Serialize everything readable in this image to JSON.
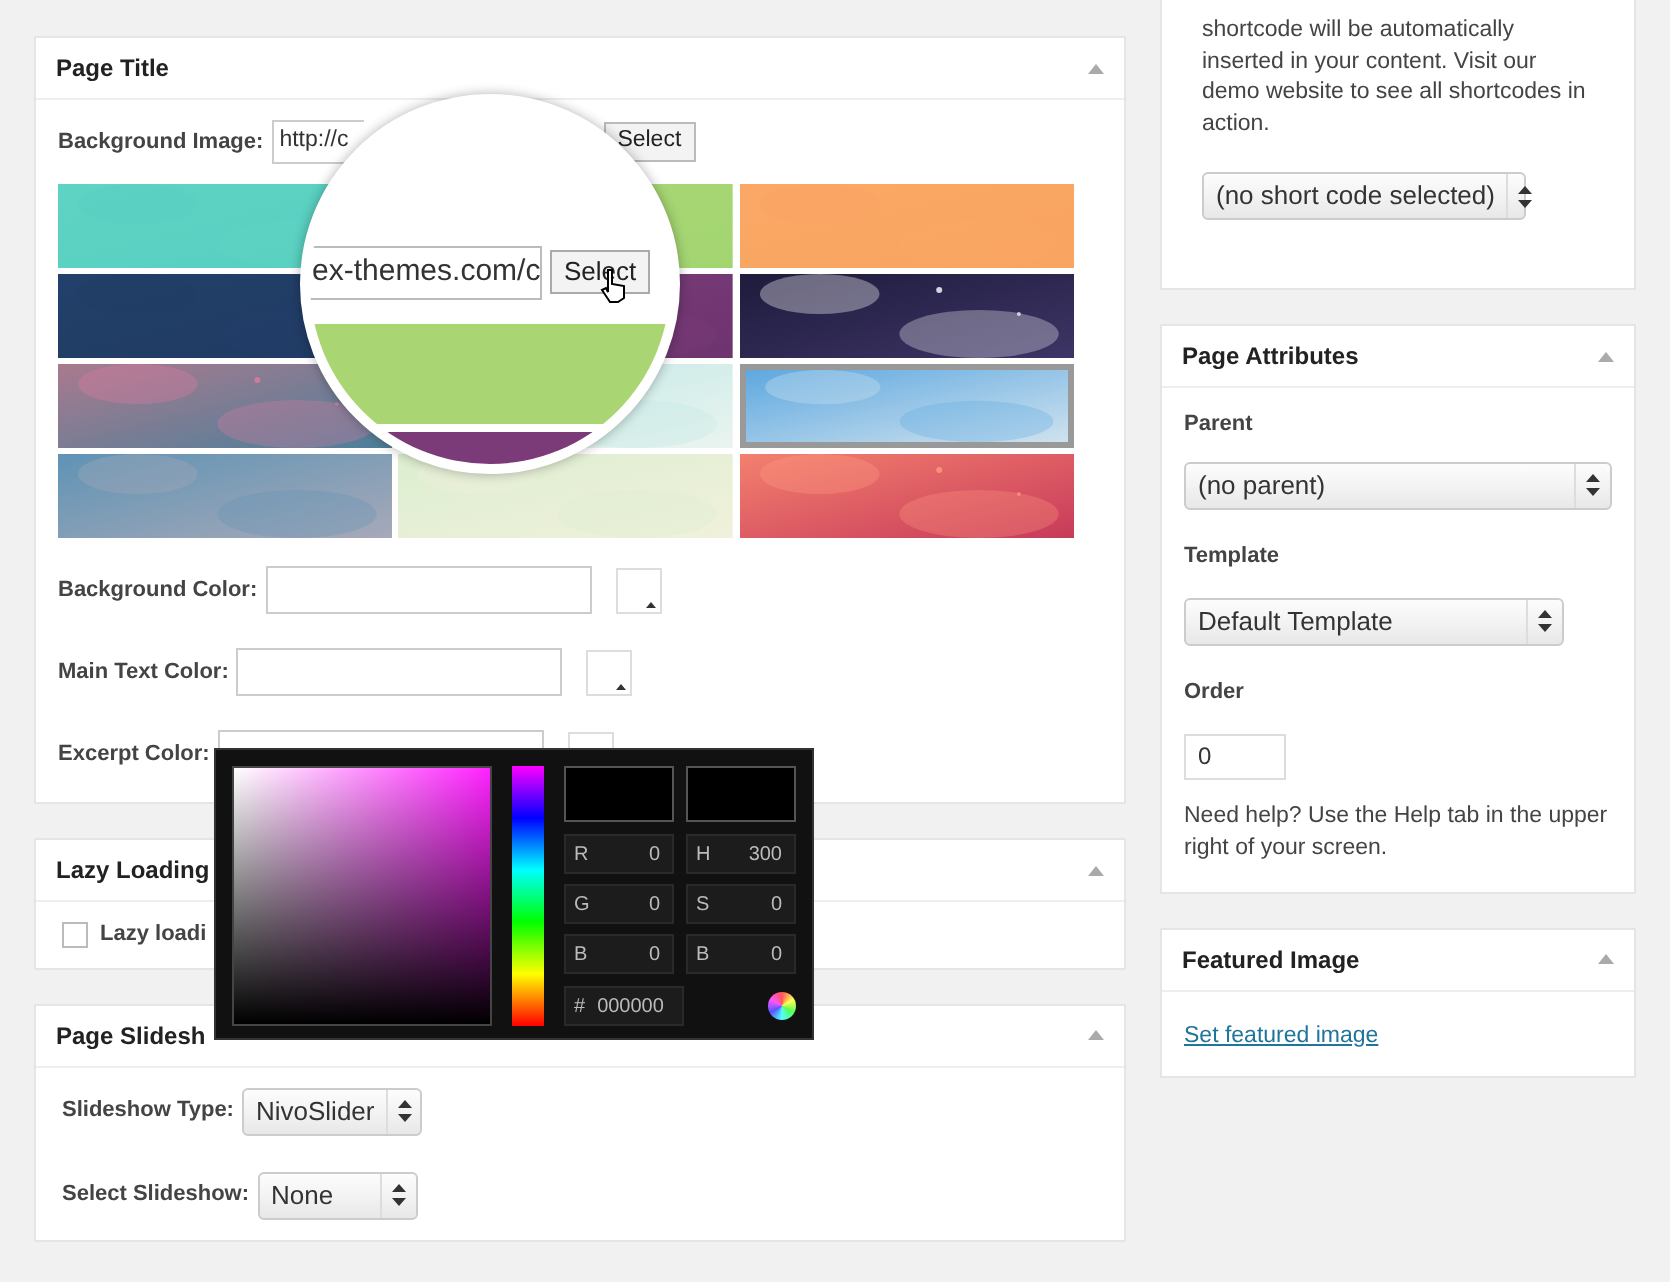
{
  "page_title_box": {
    "title": "Page Title",
    "background_image": {
      "label": "Background Image:",
      "value": "http://c",
      "button": "Select"
    },
    "images": [
      {
        "kind": "picture",
        "selected": false
      },
      {
        "kind": "picture",
        "selected": false
      },
      {
        "kind": "picture",
        "selected": false
      },
      {
        "kind": "picture",
        "selected": false
      },
      {
        "kind": "picture",
        "selected": false
      },
      {
        "kind": "picture",
        "selected": false
      },
      {
        "kind": "picture",
        "selected": false
      },
      {
        "kind": "picture",
        "selected": false
      },
      {
        "kind": "picture",
        "selected": true
      },
      {
        "kind": "picture",
        "selected": false
      },
      {
        "kind": "picture",
        "selected": false
      },
      {
        "kind": "picture",
        "selected": false
      }
    ],
    "magnifier": {
      "value": "ex-themes.com/c",
      "button": "Select"
    },
    "color_fields": [
      {
        "label": "Background Color:"
      },
      {
        "label": "Main Text Color:"
      },
      {
        "label": "Excerpt Color:"
      }
    ]
  },
  "color_picker": {
    "channels": [
      {
        "label": "R",
        "value": "0"
      },
      {
        "label": "H",
        "value": "300"
      },
      {
        "label": "G",
        "value": "0"
      },
      {
        "label": "S",
        "value": "0"
      },
      {
        "label": "B",
        "value": "0"
      },
      {
        "label": "B",
        "value": "0"
      }
    ],
    "hex_label": "#",
    "hex": "000000"
  },
  "lazy_loading": {
    "title": "Lazy Loading",
    "checkbox": {
      "label": "Lazy loadi",
      "checked": false
    }
  },
  "page_slideshow": {
    "title": "Page Slidesh",
    "fields": [
      {
        "label": "Slideshow Type:",
        "value": "NivoSlider"
      },
      {
        "label": "Select Slideshow:",
        "value": "None"
      }
    ]
  },
  "shortcodes": {
    "text": "shortcode will be automatically inserted in your content. Visit our demo website to see all shortcodes in action.",
    "select": "(no short code selected)"
  },
  "page_attributes": {
    "title": "Page Attributes",
    "parent_label": "Parent",
    "parent": "(no parent)",
    "template_label": "Template",
    "template": "Default Template",
    "order_label": "Order",
    "order": "0",
    "help": "Need help? Use the Help tab in the upper right of your screen."
  },
  "featured_image": {
    "title": "Featured Image",
    "link": "Set featured image"
  }
}
